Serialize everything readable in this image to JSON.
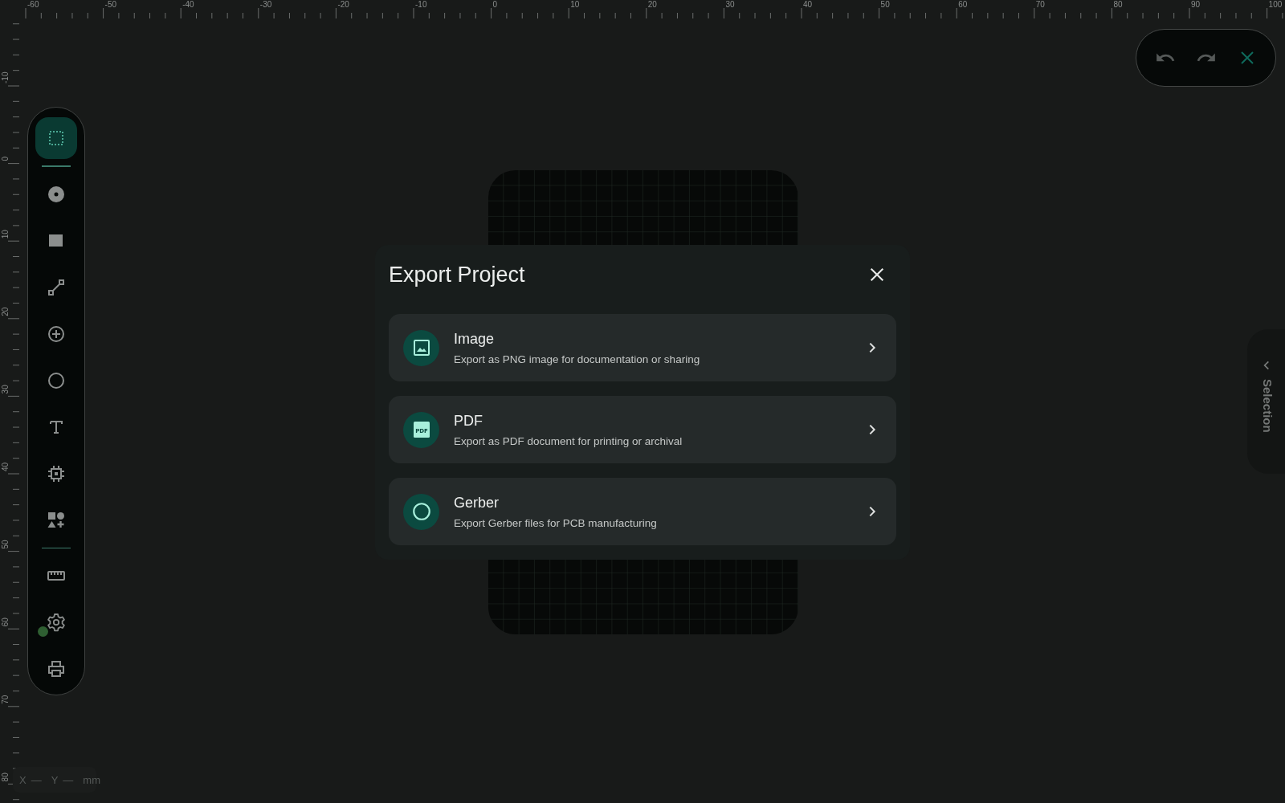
{
  "ruler_top": {
    "labels": [
      "-60",
      "-50",
      "-40",
      "-30",
      "-20",
      "-10",
      "0",
      "10",
      "20",
      "30",
      "40",
      "50",
      "60",
      "70",
      "80",
      "90",
      "100"
    ]
  },
  "ruler_left": {
    "labels": [
      "-10",
      "0",
      "10",
      "20",
      "30",
      "40",
      "50",
      "60",
      "70",
      "80"
    ]
  },
  "toolbar": {
    "groups": [
      {
        "tools": [
          {
            "kind": "select",
            "selected": true
          }
        ]
      },
      {
        "tools": [
          {
            "kind": "pad",
            "selected": false
          },
          {
            "kind": "rect",
            "selected": false
          },
          {
            "kind": "line",
            "selected": false
          },
          {
            "kind": "add",
            "selected": false
          },
          {
            "kind": "circle",
            "selected": false
          },
          {
            "kind": "text",
            "selected": false
          },
          {
            "kind": "chip",
            "selected": false
          },
          {
            "kind": "shapes",
            "selected": false
          }
        ]
      },
      {
        "tools": [
          {
            "kind": "measure",
            "selected": false
          },
          {
            "kind": "settings",
            "selected": false
          },
          {
            "kind": "print",
            "selected": false
          }
        ]
      }
    ],
    "status_dot": {
      "color": "#2f5f32"
    }
  },
  "history": {
    "actions": [
      {
        "kind": "undo"
      },
      {
        "kind": "redo"
      },
      {
        "kind": "close"
      }
    ]
  },
  "side_panel": {
    "label": "Selection"
  },
  "coordinates": {
    "items": [
      {
        "axis": "X",
        "value": "—"
      },
      {
        "axis": "Y",
        "value": "—"
      }
    ],
    "unit": "mm"
  },
  "dialog": {
    "title": "Export Project",
    "options": [
      {
        "kind": "image",
        "title": "Image",
        "description": "Export as PNG image for documentation or sharing"
      },
      {
        "kind": "pdf",
        "badge": "PDF",
        "title": "PDF",
        "description": "Export as PDF document for printing or archival"
      },
      {
        "kind": "gerber",
        "title": "Gerber",
        "description": "Export Gerber files for PCB manufacturing"
      }
    ]
  }
}
